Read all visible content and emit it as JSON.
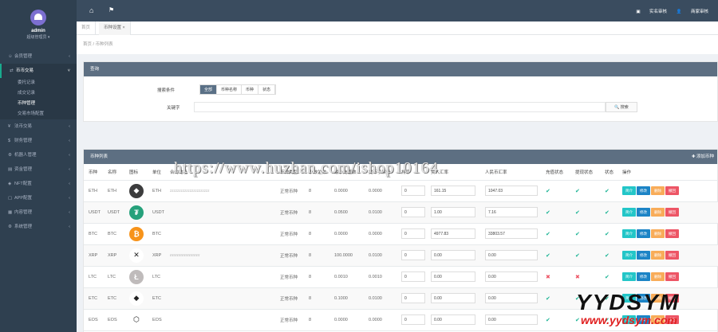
{
  "profile": {
    "name": "admin",
    "role": "超级管理员 ▾"
  },
  "sidebar": {
    "items": [
      {
        "label": "会员管理",
        "icon": "user-icon"
      },
      {
        "label": "币币交易",
        "icon": "exchange-icon",
        "open": true
      },
      {
        "label": "法币交易",
        "icon": "money-icon"
      },
      {
        "label": "财务管理",
        "icon": "finance-icon"
      },
      {
        "label": "机器人管理",
        "icon": "robot-icon"
      },
      {
        "label": "资金管理",
        "icon": "wallet-icon"
      },
      {
        "label": "NFT配置",
        "icon": "nft-icon"
      },
      {
        "label": "APP配置",
        "icon": "app-icon"
      },
      {
        "label": "内容管理",
        "icon": "content-icon"
      },
      {
        "label": "系统管理",
        "icon": "settings-icon"
      }
    ],
    "sub_items": [
      "委托记录",
      "成交记录",
      "币种管理",
      "交易市场配置"
    ]
  },
  "topbar": {
    "right_links": [
      "实名审核",
      "商家审核"
    ]
  },
  "tabs": [
    {
      "label": "首页"
    },
    {
      "label": "币种设置 ×"
    }
  ],
  "breadcrumb": "首页 / 币种列表",
  "search": {
    "panel_title": "查询",
    "type_label": "搜索条件",
    "segments": [
      "全部",
      "币种名称",
      "币种",
      "状态"
    ],
    "keyword_label": "关键字",
    "search_button": "🔍 搜索"
  },
  "table": {
    "title": "币种列表",
    "add_label": "✚ 添加币种",
    "headers": [
      "币种",
      "名称",
      "图标",
      "单位",
      "合约地址",
      "币种类型",
      "小数位数",
      "最小充值数",
      "提币手续费",
      "排序",
      "买入汇率",
      "人民币汇率",
      "充值状态",
      "提现状态",
      "状态",
      "操作"
    ],
    "actions": [
      "简介",
      "修改",
      "删除",
      "撤回"
    ],
    "rows": [
      {
        "sym": "ETH",
        "name": "ETH",
        "icon": "eth-icon",
        "color": "#3c3c3d",
        "glyph": "◆",
        "unit": "ETH",
        "addr": "zzzzzzzzzzzzzzzzzzzzzz",
        "type": "正常币种",
        "dec": "8",
        "min": "0.0000",
        "fee": "0.0000",
        "sort": "0",
        "buy": "161.15",
        "cny": "1047.03",
        "dep": "ok",
        "wd": "ok",
        "st": "ok"
      },
      {
        "sym": "USDT",
        "name": "USDT",
        "icon": "usdt-icon",
        "color": "#26a17b",
        "glyph": "₮",
        "unit": "USDT",
        "addr": "",
        "type": "正常币种",
        "dec": "8",
        "min": "0.0500",
        "fee": "0.0100",
        "sort": "0",
        "buy": "1.00",
        "cny": "7.16",
        "dep": "ok",
        "wd": "ok",
        "st": "ok"
      },
      {
        "sym": "BTC",
        "name": "BTC",
        "icon": "btc-icon",
        "color": "#f7931a",
        "glyph": "₿",
        "unit": "BTC",
        "addr": "",
        "type": "正常币种",
        "dec": "8",
        "min": "0.0000",
        "fee": "0.0000",
        "sort": "0",
        "buy": "4977.83",
        "cny": "33803.57",
        "dep": "ok",
        "wd": "ok",
        "st": "ok"
      },
      {
        "sym": "XRP",
        "name": "XRP",
        "icon": "xrp-icon",
        "color": "#ffffff",
        "glyph": "✕",
        "unit": "XRP",
        "addr": "rrrrrrrrrrrrrrrrrrrrrrrrr",
        "type": "正常币种",
        "dec": "8",
        "min": "100.0000",
        "fee": "0.0100",
        "sort": "0",
        "buy": "0.00",
        "cny": "0.00",
        "dep": "ok",
        "wd": "ok",
        "st": "ok"
      },
      {
        "sym": "LTC",
        "name": "LTC",
        "icon": "ltc-icon",
        "color": "#bfbbbb",
        "glyph": "Ł",
        "unit": "LTC",
        "addr": "",
        "type": "正常币种",
        "dec": "8",
        "min": "0.0010",
        "fee": "0.0010",
        "sort": "0",
        "buy": "0.00",
        "cny": "0.00",
        "dep": "no",
        "wd": "no",
        "st": "ok"
      },
      {
        "sym": "ETC",
        "name": "ETC",
        "icon": "etc-icon",
        "color": "#ffffff",
        "glyph": "◆",
        "unit": "ETC",
        "addr": "",
        "type": "正常币种",
        "dec": "8",
        "min": "0.1000",
        "fee": "0.0100",
        "sort": "0",
        "buy": "0.00",
        "cny": "0.00",
        "dep": "ok",
        "wd": "ok",
        "st": "ok"
      },
      {
        "sym": "EOS",
        "name": "EOS",
        "icon": "eos-icon",
        "color": "#ffffff",
        "glyph": "⬡",
        "unit": "EOS",
        "addr": "",
        "type": "正常币种",
        "dec": "8",
        "min": "0.0000",
        "fee": "0.0000",
        "sort": "0",
        "buy": "0.00",
        "cny": "0.00",
        "dep": "ok",
        "wd": "ok",
        "st": "ok"
      }
    ]
  },
  "watermark": "https://www.huzhan.com/ishop10164",
  "logo": {
    "big": "YYDSYM",
    "small": "www.yydsym.com"
  }
}
